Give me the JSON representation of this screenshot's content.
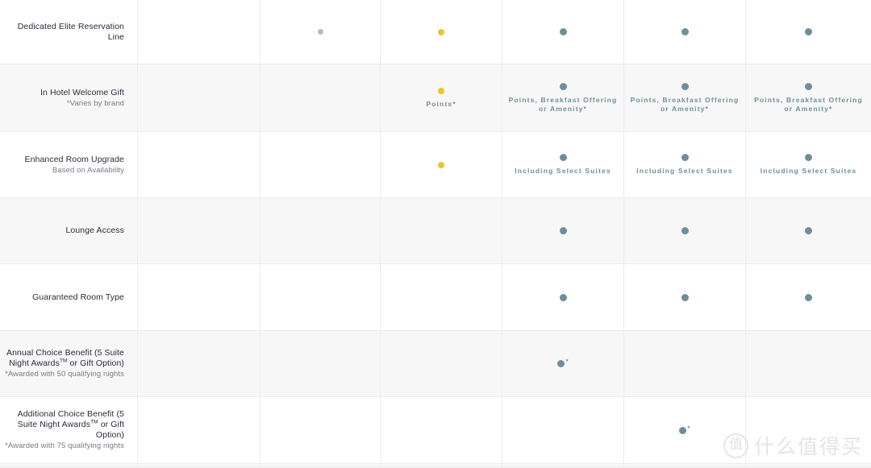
{
  "table": {
    "columns": [
      {
        "key": "label",
        "header": ""
      },
      {
        "key": "tier1",
        "header": ""
      },
      {
        "key": "tier2",
        "header": ""
      },
      {
        "key": "tier3",
        "header": ""
      },
      {
        "key": "tier4",
        "header": ""
      },
      {
        "key": "tier5",
        "header": ""
      },
      {
        "key": "tier6",
        "header": ""
      }
    ],
    "colors": {
      "grey_dot": "#bcbcbc",
      "gold_dot": "#edc331",
      "teal_dot": "#6f8f98",
      "caption_teal": "#6f8f98",
      "caption_grey": "#87888c",
      "label_text": "#2b2b3a",
      "sublabel_text": "#7a7a86",
      "row_shade": "#f7f7f7",
      "row_plain": "#ffffff",
      "grid_line": "#ececec"
    },
    "rows": [
      {
        "shade": "plain",
        "label": "Dedicated Elite Reservation Line",
        "sublabel": "",
        "cells": [
          {
            "dot": "none",
            "caption": ""
          },
          {
            "dot": "grey",
            "caption": ""
          },
          {
            "dot": "gold",
            "caption": ""
          },
          {
            "dot": "teal",
            "caption": ""
          },
          {
            "dot": "teal",
            "caption": ""
          },
          {
            "dot": "teal",
            "caption": ""
          }
        ]
      },
      {
        "shade": "shade",
        "label": "In Hotel Welcome Gift",
        "sublabel": "*Varies by brand",
        "cells": [
          {
            "dot": "none",
            "caption": ""
          },
          {
            "dot": "none",
            "caption": ""
          },
          {
            "dot": "gold",
            "caption": "Points*",
            "caption_color": "grey"
          },
          {
            "dot": "teal",
            "caption": "Points, Breakfast Offering or Amenity*"
          },
          {
            "dot": "teal",
            "caption": "Points, Breakfast Offering or Amenity*"
          },
          {
            "dot": "teal",
            "caption": "Points, Breakfast Offering or Amenity*"
          }
        ]
      },
      {
        "shade": "plain",
        "label": "Enhanced Room Upgrade",
        "sublabel": "Based on Availability",
        "cells": [
          {
            "dot": "none",
            "caption": ""
          },
          {
            "dot": "none",
            "caption": ""
          },
          {
            "dot": "gold",
            "caption": ""
          },
          {
            "dot": "teal",
            "caption": "Including Select Suites"
          },
          {
            "dot": "teal",
            "caption": "Including Select Suites"
          },
          {
            "dot": "teal",
            "caption": "Including Select Suites"
          }
        ]
      },
      {
        "shade": "shade",
        "label": "Lounge Access",
        "sublabel": "",
        "cells": [
          {
            "dot": "none",
            "caption": ""
          },
          {
            "dot": "none",
            "caption": ""
          },
          {
            "dot": "none",
            "caption": ""
          },
          {
            "dot": "teal",
            "caption": ""
          },
          {
            "dot": "teal",
            "caption": ""
          },
          {
            "dot": "teal",
            "caption": ""
          }
        ]
      },
      {
        "shade": "plain",
        "label": "Guaranteed Room Type",
        "sublabel": "",
        "cells": [
          {
            "dot": "none",
            "caption": ""
          },
          {
            "dot": "none",
            "caption": ""
          },
          {
            "dot": "none",
            "caption": ""
          },
          {
            "dot": "teal",
            "caption": ""
          },
          {
            "dot": "teal",
            "caption": ""
          },
          {
            "dot": "teal",
            "caption": ""
          }
        ]
      },
      {
        "shade": "shade",
        "label": "Annual Choice Benefit (5 Suite Night Awards^TM^ or Gift Option)",
        "sublabel": "*Awarded with 50 qualifying nights",
        "cells": [
          {
            "dot": "none",
            "caption": ""
          },
          {
            "dot": "none",
            "caption": ""
          },
          {
            "dot": "none",
            "caption": ""
          },
          {
            "dot": "teal",
            "star": "*",
            "caption": ""
          },
          {
            "dot": "none",
            "caption": ""
          },
          {
            "dot": "none",
            "caption": ""
          }
        ]
      },
      {
        "shade": "plain",
        "label": "Additional Choice Benefit (5 Suite Night Awards^TM^ or Gift Option)",
        "sublabel": "*Awarded with 75 qualifying nights",
        "cells": [
          {
            "dot": "none",
            "caption": ""
          },
          {
            "dot": "none",
            "caption": ""
          },
          {
            "dot": "none",
            "caption": ""
          },
          {
            "dot": "none",
            "caption": ""
          },
          {
            "dot": "teal",
            "star": "*",
            "caption": ""
          },
          {
            "dot": "none",
            "caption": ""
          }
        ]
      },
      {
        "shade": "shade",
        "label": "",
        "sublabel": "",
        "cells": [
          {
            "dot": "none",
            "caption": ""
          },
          {
            "dot": "none",
            "caption": ""
          },
          {
            "dot": "none",
            "caption": ""
          },
          {
            "dot": "none",
            "caption": ""
          },
          {
            "dot": "none",
            "caption": ""
          },
          {
            "dot": "none",
            "caption": ""
          }
        ]
      }
    ]
  },
  "watermark": {
    "badge": "值",
    "text": "什么值得买"
  }
}
